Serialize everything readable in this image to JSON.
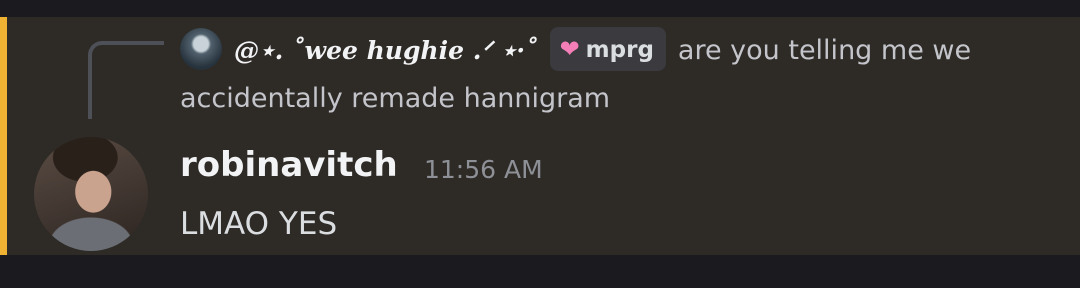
{
  "reply": {
    "author": "@⋆. ˚wee hughie .ᐟ ⋆·˚",
    "role_icon": "pink-heart-icon",
    "role_label": "mprg",
    "text_line1": "are you telling me we",
    "text_line2": "accidentally remade hannigram"
  },
  "message": {
    "author": "robinavitch",
    "timestamp": "11:56 AM",
    "body": "LMAO YES"
  },
  "colors": {
    "mention_bar": "#f0b232",
    "row_background": "#2e2a26",
    "page_background": "#1b1b1f",
    "role_heart": "#f47fb8"
  }
}
